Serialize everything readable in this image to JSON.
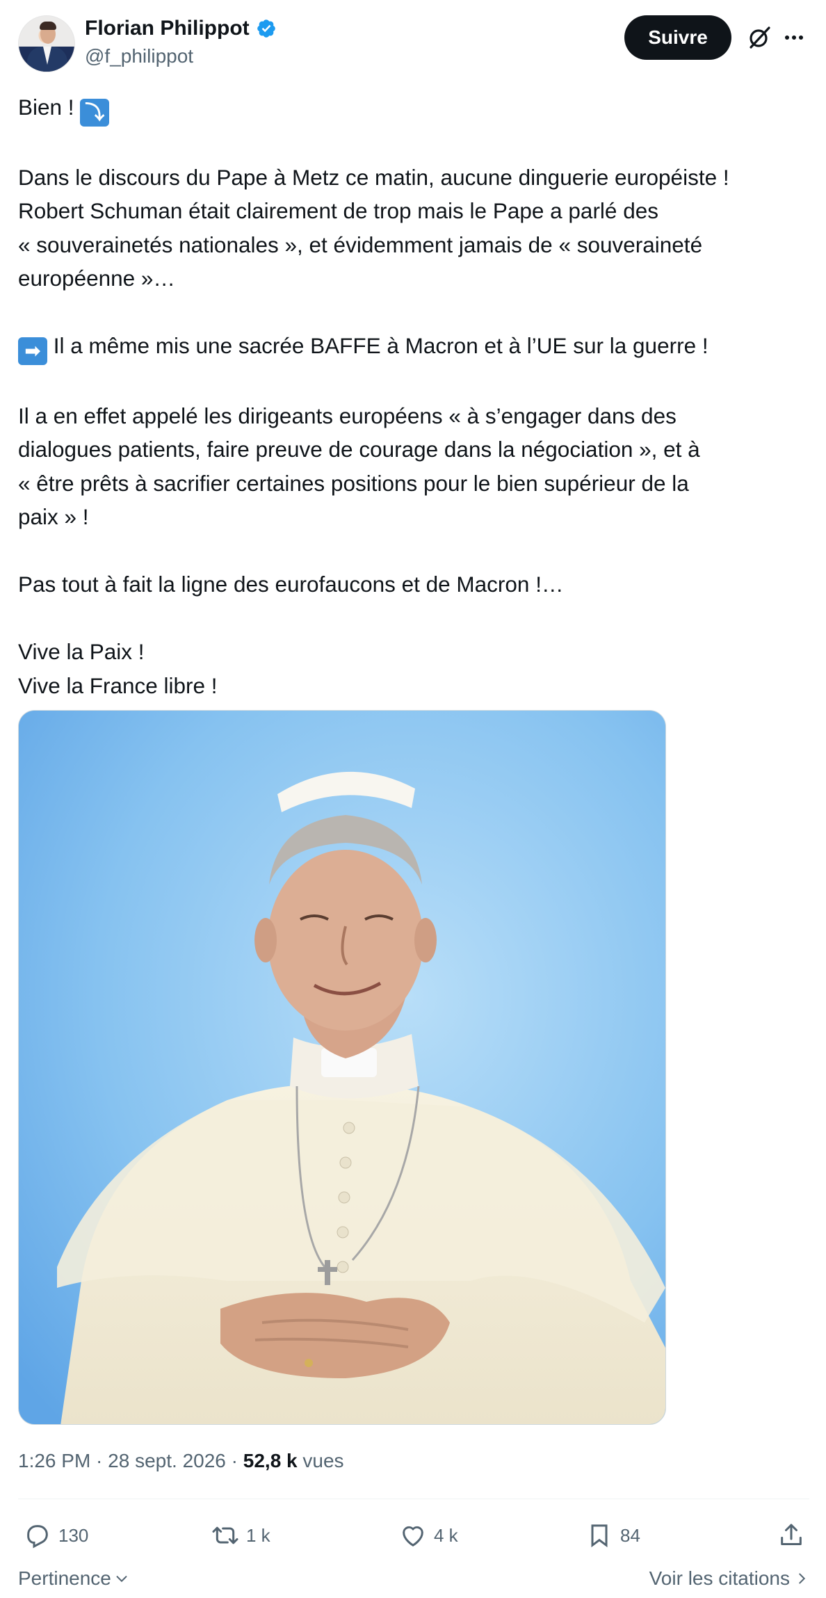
{
  "author": {
    "name": "Florian Philippot",
    "handle": "@f_philippot",
    "verified_color": "#1d9bf0"
  },
  "header": {
    "follow_label": "Suivre",
    "grok_icon": "grok-icon",
    "more_icon": "more-icon"
  },
  "tweet": {
    "line1_text": "Bien ! ",
    "line1_emoji": "⤵",
    "para2": [
      "Dans le discours du Pape à Metz ce matin, aucune dinguerie européiste !",
      "Robert Schuman était clairement de trop mais le Pape a parlé des",
      "« souverainetés nationales », et évidemment jamais de « souveraineté",
      "européenne »…"
    ],
    "para3_emoji": "➡",
    "para3_text": " Il a même mis une sacrée BAFFE à Macron et à l’UE sur la guerre !",
    "para4": [
      "Il a en effet appelé les dirigeants européens « à s’engager dans des",
      "dialogues patients, faire preuve de courage dans la négociation », et à",
      "« être prêts à sacrifier certaines positions pour le bien supérieur de la",
      "paix » !"
    ],
    "para5": "Pas tout à fait la ligne des eurofaucons et de Macron !…",
    "para6": [
      "Vive la Paix !",
      "Vive la France libre !"
    ]
  },
  "meta": {
    "time": "1:26 PM",
    "sep1": " · ",
    "date": "28 sept. 2026",
    "sep2": " · ",
    "views_count": "52,8 k",
    "views_label": " vues"
  },
  "actions": {
    "replies": "130",
    "reposts": "1 k",
    "likes": "4 k",
    "bookmarks": "84"
  },
  "footer": {
    "sort_label": "Pertinence",
    "quotes_label": "Voir les citations"
  }
}
